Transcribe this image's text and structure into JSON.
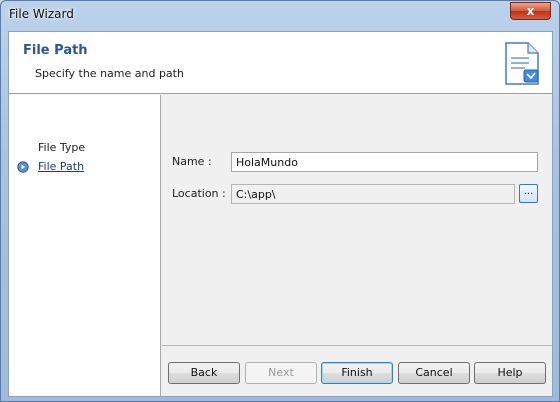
{
  "window": {
    "title": "File Wizard",
    "close_label": "x"
  },
  "header": {
    "title": "File Path",
    "subtitle": "Specify the name and path",
    "icon": "document-icon"
  },
  "nav": {
    "items": [
      {
        "label": "File Type",
        "current": false
      },
      {
        "label": "File Path",
        "current": true
      }
    ]
  },
  "form": {
    "name": {
      "label": "Name :",
      "value": "HolaMundo"
    },
    "location": {
      "label": "Location :",
      "value": "C:\\app\\",
      "browse_label": "..."
    }
  },
  "buttons": {
    "back": "Back",
    "next": "Next",
    "finish": "Finish",
    "cancel": "Cancel",
    "help": "Help"
  }
}
